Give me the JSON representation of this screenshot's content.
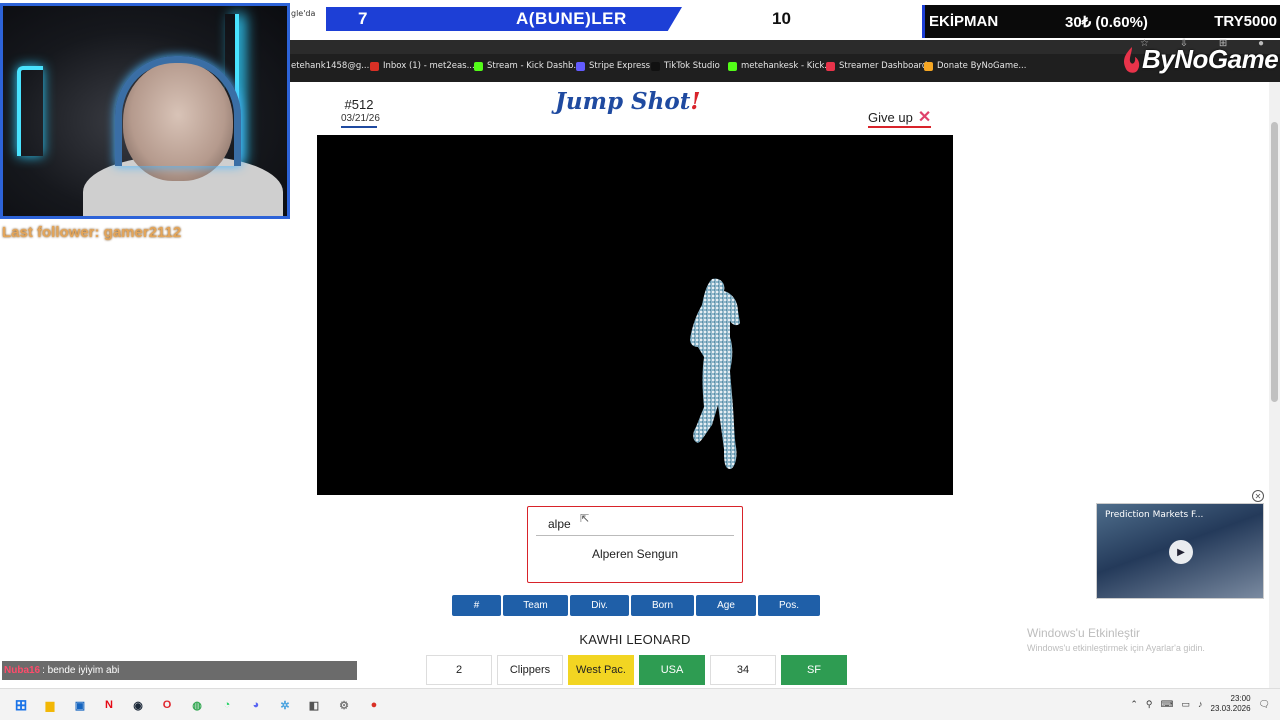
{
  "overlay": {
    "prev_tab_text": "gle'da",
    "left_score": "7",
    "team_name": "A(BUNE)LER",
    "right_score": "10",
    "ekipman_label": "EKİPMAN",
    "ekipman_pct": "30₺ (0.60%)",
    "ekipman_try": "TRY5000",
    "follower": "Last follower: gamer2112",
    "brand": "ByNoGame"
  },
  "bookmarks": [
    {
      "label": "etehank1458@g...",
      "icon": "gmail-icon",
      "color": "#cccccc"
    },
    {
      "label": "Inbox (1) - met2eas...",
      "icon": "mail-icon",
      "color": "#d93025"
    },
    {
      "label": "Stream - Kick Dashb...",
      "icon": "kick-icon",
      "color": "#53fc18"
    },
    {
      "label": "Stripe Express",
      "icon": "stripe-icon",
      "color": "#635bff"
    },
    {
      "label": "TikTok Studio",
      "icon": "tiktok-icon",
      "color": "#111111"
    },
    {
      "label": "metehankesk - Kick...",
      "icon": "kick-icon",
      "color": "#53fc18"
    },
    {
      "label": "Streamer Dashboard",
      "icon": "dashboard-icon",
      "color": "#e8334a"
    },
    {
      "label": "Donate ByNoGame...",
      "icon": "donate-icon",
      "color": "#f5a623"
    }
  ],
  "game": {
    "puzzle_number": "#512",
    "puzzle_date": "03/21/26",
    "title": "Jump Shot",
    "title_bang": "!",
    "give_up": "Give up",
    "input_value": "alpe",
    "suggestion": "Alperen Sengun",
    "columns": [
      "#",
      "Team",
      "Div.",
      "Born",
      "Age",
      "Pos."
    ],
    "guesses": [
      {
        "name": "KAWHI LEONARD",
        "cells": [
          {
            "value": "2",
            "status": "none"
          },
          {
            "value": "Clippers",
            "status": "none"
          },
          {
            "value": "West Pac.",
            "status": "partial"
          },
          {
            "value": "USA",
            "status": "correct"
          },
          {
            "value": "34",
            "status": "none"
          },
          {
            "value": "SF",
            "status": "correct"
          }
        ]
      }
    ]
  },
  "ad": {
    "title": "Prediction Markets F..."
  },
  "activation": {
    "line1": "Windows'u Etkinleştir",
    "line2": "Windows'u etkinleştirmek için Ayarlar'a gidin."
  },
  "chat": {
    "user": "Nuba16",
    "message": ": bende iyiyim abi"
  },
  "taskbar": {
    "time": "23:00",
    "date": "23.03.2026"
  }
}
